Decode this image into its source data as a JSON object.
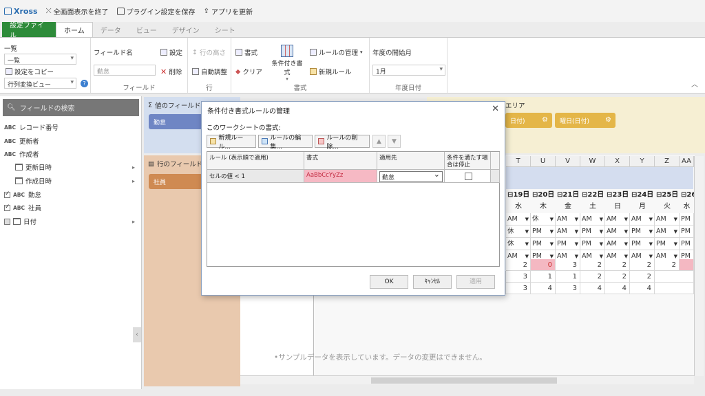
{
  "titlebar": {
    "app_name": "Xross",
    "items": [
      {
        "label": "全画面表示を終了"
      },
      {
        "label": "プラグイン設定を保存"
      },
      {
        "label": "アプリを更新"
      }
    ]
  },
  "tabs": [
    {
      "label": "設定ファイル"
    },
    {
      "label": "ホーム"
    },
    {
      "label": "データ"
    },
    {
      "label": "ビュー"
    },
    {
      "label": "デザイン"
    },
    {
      "label": "シート"
    }
  ],
  "ribbon": {
    "list_label": "一覧",
    "list_value": "一覧",
    "copy_settings": "設定をコピー",
    "view_select": "行列変換ビュー",
    "field_name_label": "フィールド名",
    "field_name_value": "勤怠",
    "settings": "設定",
    "delete": "削除",
    "field_group": "フィールド",
    "row_height": "行の高さ",
    "auto_adjust": "自動調整",
    "row_group": "行",
    "format": "書式",
    "clear": "クリア",
    "conditional_format": "条件付き書式",
    "manage_rules": "ルールの管理",
    "new_rule": "新規ルール",
    "format_group": "書式",
    "fiscal_start_label": "年度の開始月",
    "fiscal_start_value": "1月",
    "fiscal_group": "年度日付"
  },
  "leftpanel": {
    "search_placeholder": "フィールドの検索",
    "fields": [
      {
        "type": "ABC",
        "label": "レコード番号"
      },
      {
        "type": "ABC",
        "label": "更新者"
      },
      {
        "type": "ABC",
        "label": "作成者"
      },
      {
        "type": "date",
        "label": "更新日時"
      },
      {
        "type": "date",
        "label": "作成日時"
      },
      {
        "type": "ABC",
        "label": "勤怠"
      },
      {
        "type": "ABC",
        "label": "社員"
      },
      {
        "type": "date",
        "label": "日付"
      }
    ]
  },
  "panels": {
    "value_title": "値のフィールド ド",
    "value_chip": "勤怠",
    "row_title": "行のフィールド",
    "row_chip": "社員",
    "col_title": "エリア",
    "col_chip1": "日付)",
    "col_chip2": "曜日(日付)"
  },
  "grid": {
    "col_headers": [
      "T",
      "U",
      "V",
      "W",
      "X",
      "Y",
      "Z",
      "AA"
    ],
    "dates": [
      "⊟19日",
      "⊟20日",
      "⊟21日",
      "⊟22日",
      "⊟23日",
      "⊟24日",
      "⊟25日",
      "⊟26"
    ],
    "dows": [
      "水",
      "木",
      "金",
      "土",
      "日",
      "月",
      "火",
      "水"
    ],
    "rows": [
      [
        "AM",
        "休",
        "AM",
        "AM",
        "AM",
        "AM",
        "AM",
        "PM"
      ],
      [
        "休",
        "PM",
        "AM",
        "PM",
        "AM",
        "PM",
        "AM",
        "PM"
      ],
      [
        "休",
        "PM",
        "PM",
        "PM",
        "AM",
        "PM",
        "PM",
        "PM"
      ],
      [
        "AM",
        "PM",
        "AM",
        "AM",
        "AM",
        "AM",
        "AM",
        "PM"
      ]
    ],
    "counts": [
      [
        "2",
        "0",
        "3",
        "2",
        "2",
        "2",
        "2",
        ""
      ],
      [
        "0",
        "3",
        "1",
        "1",
        "2",
        "2",
        "2",
        ""
      ],
      [
        "2",
        "3",
        "4",
        "3",
        "4",
        "4",
        "4",
        ""
      ]
    ],
    "sample_note": "•サンプルデータを表示しています。データの変更はできません。"
  },
  "dialog": {
    "title": "条件付き書式ルールの管理",
    "close": "✕",
    "subtitle": "このワークシートの書式:",
    "btn_new": "新規ルール...",
    "btn_edit": "ルールの編集...",
    "btn_delete": "ルールの削除...",
    "col_rule": "ルール (表示順で適用)",
    "col_format": "書式",
    "col_apply": "適用先",
    "col_stop": "条件を満たす場合は停止",
    "rule_text": "セルの値 < 1",
    "format_preview": "AaBbCcYyZz",
    "apply_value": "勤怠",
    "ok": "OK",
    "cancel": "ｷｬﾝｾﾙ",
    "apply": "適用"
  }
}
